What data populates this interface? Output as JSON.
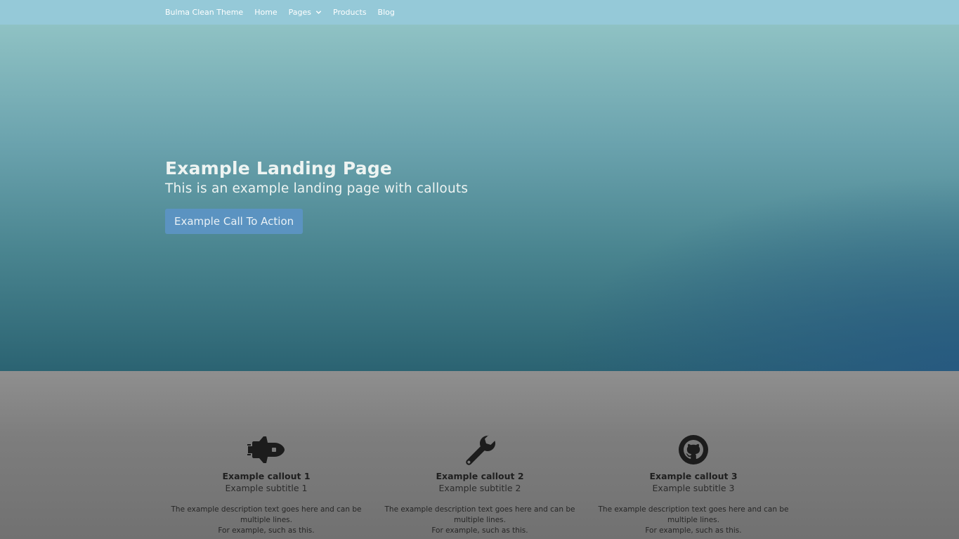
{
  "navbar": {
    "brand": "Bulma Clean Theme",
    "items": [
      {
        "label": "Home"
      },
      {
        "label": "Pages",
        "has_dropdown": true
      },
      {
        "label": "Products"
      },
      {
        "label": "Blog"
      }
    ]
  },
  "hero": {
    "title": "Example Landing Page",
    "subtitle": "This is an example landing page with callouts",
    "cta_label": "Example Call To Action"
  },
  "callouts": [
    {
      "icon": "space-shuttle-icon",
      "title": "Example callout 1",
      "subtitle": "Example subtitle 1",
      "description_line1": "The example description text goes here and can be multiple lines.",
      "description_line2": "For example, such as this."
    },
    {
      "icon": "wrench-icon",
      "title": "Example callout 2",
      "subtitle": "Example subtitle 2",
      "description_line1": "The example description text goes here and can be multiple lines.",
      "description_line2": "For example, such as this."
    },
    {
      "icon": "github-icon",
      "title": "Example callout 3",
      "subtitle": "Example subtitle 3",
      "description_line1": "The example description text goes here and can be multiple lines.",
      "description_line2": "For example, such as this."
    }
  ],
  "colors": {
    "navbar_bg": "#95c9d8",
    "cta_bg": "#5b93c1",
    "callouts_bg": "#7d7d7d"
  }
}
